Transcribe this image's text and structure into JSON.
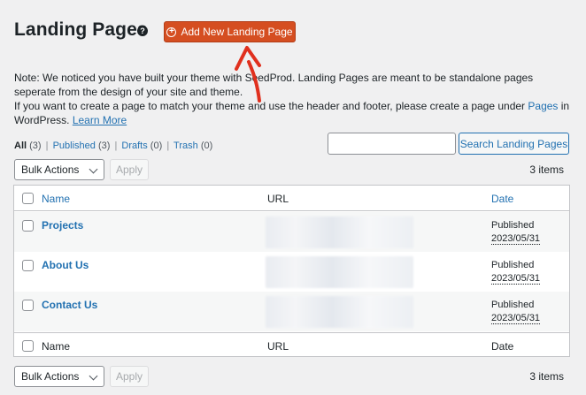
{
  "header": {
    "title": "Landing Pages",
    "help_icon": "?",
    "add_new_label": "Add New Landing Page",
    "add_new_icon": "+"
  },
  "note": {
    "line1": "Note: We noticed you have built your theme with SeedProd. Landing Pages are meant to be standalone pages seperate from the design of your site and theme.",
    "line2_start": "If you want to create a page to match your theme and use the header and footer, please create a page under ",
    "pages_link": "Pages",
    "line2_end": " in WordPress.",
    "learn_more": "Learn More"
  },
  "filters": {
    "all_label": "All",
    "all_count": "(3)",
    "published_label": "Published",
    "published_count": "(3)",
    "drafts_label": "Drafts",
    "drafts_count": "(0)",
    "trash_label": "Trash",
    "trash_count": "(0)",
    "separator": "|"
  },
  "search": {
    "placeholder": "",
    "button_label": "Search Landing Pages"
  },
  "bulk": {
    "select_label": "Bulk Actions",
    "apply_label": "Apply",
    "items_count": "3 items"
  },
  "table": {
    "columns": {
      "name": "Name",
      "url": "URL",
      "date": "Date"
    },
    "rows": [
      {
        "name": "Projects",
        "status": "Published",
        "date": "2023/05/31"
      },
      {
        "name": "About Us",
        "status": "Published",
        "date": "2023/05/31"
      },
      {
        "name": "Contact Us",
        "status": "Published",
        "date": "2023/05/31"
      }
    ]
  },
  "colors": {
    "accent_button": "#d54e21",
    "link": "#2271b1",
    "annotation_arrow": "#e0301e"
  }
}
